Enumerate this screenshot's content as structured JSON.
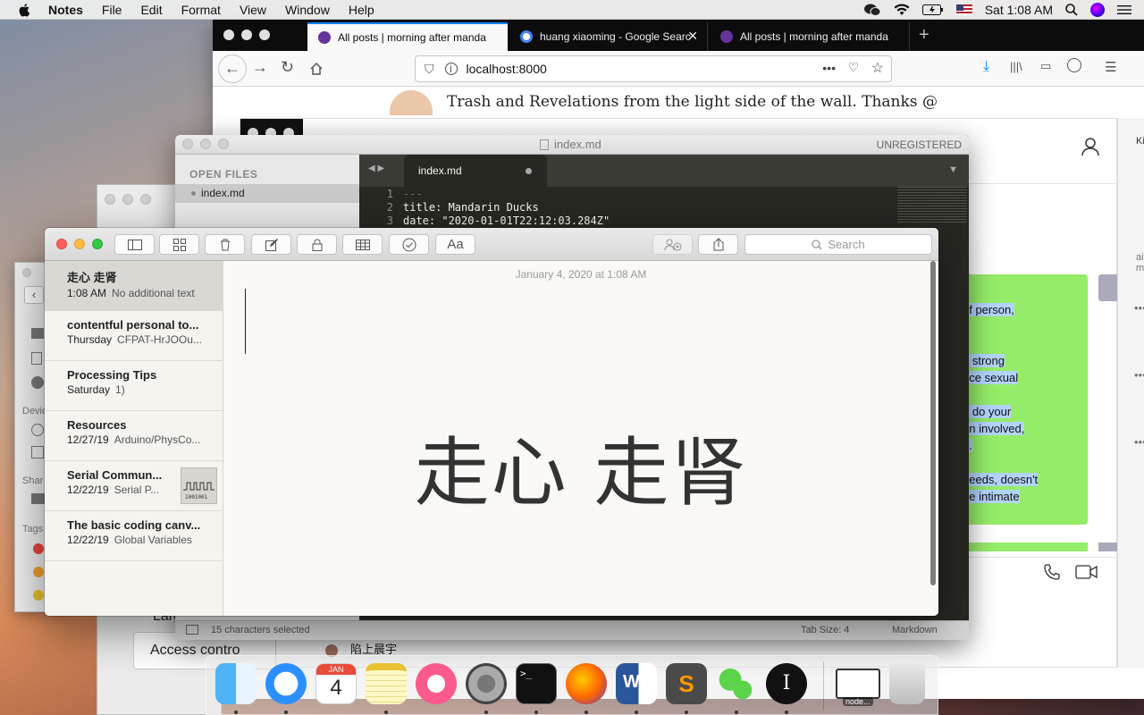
{
  "menubar": {
    "app": "Notes",
    "items": [
      "File",
      "Edit",
      "Format",
      "View",
      "Window",
      "Help"
    ],
    "clock": "Sat 1:08 AM",
    "icons": [
      "wechat-icon",
      "wifi-icon",
      "battery-icon",
      "flag-icon",
      "search-icon",
      "siri-icon",
      "control-center-icon"
    ]
  },
  "firefox": {
    "tabs": [
      {
        "label": "All posts | morning after manda"
      },
      {
        "label": "huang xiaoming - Google Searc"
      },
      {
        "label": "All posts | morning after manda"
      }
    ],
    "url": "localhost:8000",
    "page_header": "Trash and Revelations from the light side of the wall. Thanks @",
    "chat_lines": [
      "of person,",
      "a strong",
      "nce sexual",
      "e do your",
      "on involved,",
      "h.",
      "needs, doesn't",
      "be intimate"
    ],
    "side_label_1": "Ki",
    "side_label_2": "ain ma",
    "bg_text_1": "Larg",
    "bg_text_2": "Access contro",
    "bg_text_3": "陷上晨宇"
  },
  "sublime": {
    "title": "index.md",
    "registration": "UNREGISTERED",
    "sidebar_header": "OPEN FILES",
    "sidebar_file": "index.md",
    "tab_label": "index.md",
    "lines": [
      {
        "num": "1",
        "text": "---"
      },
      {
        "num": "2",
        "text": "title: Mandarin Ducks"
      },
      {
        "num": "3",
        "text": "date: \"2020-01-01T22:12:03.284Z\""
      }
    ],
    "status_left": "15 characters selected",
    "status_tab": "Tab Size: 4",
    "status_syntax": "Markdown"
  },
  "finder": {
    "devices_label": "Devic",
    "shared_label": "Shar",
    "tags_label": "Tags",
    "tag_colors": [
      "#e8443a",
      "#f0a030",
      "#e6c22c"
    ]
  },
  "notes": {
    "search_placeholder": "Search",
    "list": [
      {
        "title": "走心 走肾",
        "date": "1:08 AM",
        "preview": "No additional text",
        "selected": true
      },
      {
        "title": "contentful personal to...",
        "date": "Thursday",
        "preview": "CFPAT-HrJOOu...",
        "selected": false
      },
      {
        "title": "Processing Tips",
        "date": "Saturday",
        "preview": "1)",
        "selected": false
      },
      {
        "title": "Resources",
        "date": "12/27/19",
        "preview": "Arduino/PhysCo...",
        "selected": false
      },
      {
        "title": "Serial Commun...",
        "date": "12/22/19",
        "preview": "Serial P...",
        "selected": false,
        "thumbnail": true
      },
      {
        "title": "The basic coding canv...",
        "date": "12/22/19",
        "preview": "Global Variables",
        "selected": false
      }
    ],
    "editor_date": "January 4, 2020 at 1:08 AM",
    "editor_body": "走心 走肾"
  },
  "dock": {
    "calendar_month": "JAN",
    "calendar_day": "4",
    "node_label": "node..."
  }
}
